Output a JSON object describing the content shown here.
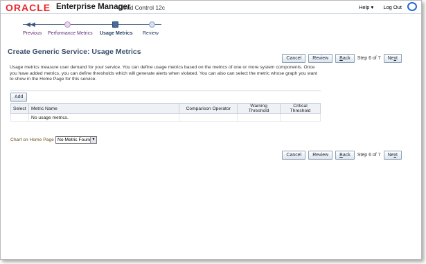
{
  "header": {
    "brand": "ORACLE",
    "product": "Enterprise Manager",
    "edition": "Cloud Control 12c",
    "help_label": "Help ▾",
    "logout_label": "Log Out"
  },
  "train": {
    "steps": [
      {
        "label": "Previous"
      },
      {
        "label": "Performance Metrics"
      },
      {
        "label": "Usage Metrics"
      },
      {
        "label": "Review"
      }
    ]
  },
  "page": {
    "title": "Create Generic Service: Usage Metrics",
    "description": "Usage metrics measure user demand for your service. You can define usage metrics based on the metrics of one or more system components. Once you have added metrics, you can define thresholds which will generate alerts when violated. You can also can select the metric whose graph you want to show in the Home Page for this service."
  },
  "nav": {
    "cancel": "Cancel",
    "review": "Review",
    "back_prefix": "B",
    "back_suffix": "ack",
    "step_text": "Step 6 of 7",
    "next_prefix": "Ne",
    "next_accel": "x",
    "next_suffix": "t"
  },
  "table": {
    "add_label": "Add",
    "columns": [
      "Select",
      "Metric Name",
      "Comparison Operator",
      "Warning Threshold",
      "Critical Threshold"
    ],
    "empty_text": "No usage metrics."
  },
  "chart_home": {
    "label": "Chart on Home Page",
    "selected": "No Metric Found"
  }
}
